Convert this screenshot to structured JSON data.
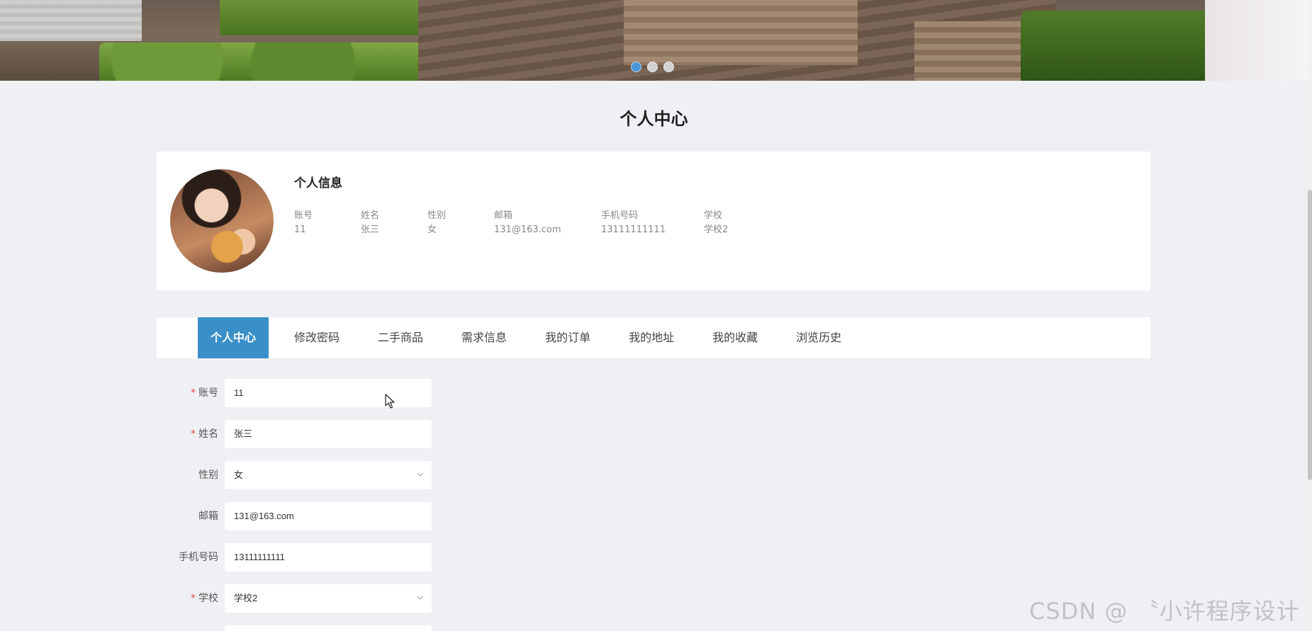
{
  "banner": {
    "slides": 3,
    "active_slide": 1,
    "accent_color": "#4a97d6"
  },
  "page": {
    "title": "个人中心"
  },
  "profile": {
    "heading": "个人信息",
    "fields": [
      {
        "key": "账号",
        "value": "11"
      },
      {
        "key": "姓名",
        "value": "张三"
      },
      {
        "key": "性别",
        "value": "女"
      },
      {
        "key": "邮箱",
        "value": "131@163.com"
      },
      {
        "key": "手机号码",
        "value": "13111111111"
      },
      {
        "key": "学校",
        "value": "学校2"
      }
    ]
  },
  "tabs": [
    {
      "label": "个人中心",
      "active": true
    },
    {
      "label": "修改密码"
    },
    {
      "label": "二手商品"
    },
    {
      "label": "需求信息"
    },
    {
      "label": "我的订单"
    },
    {
      "label": "我的地址"
    },
    {
      "label": "我的收藏"
    },
    {
      "label": "浏览历史"
    }
  ],
  "form": {
    "account": {
      "label": "账号",
      "required": "*",
      "value": "11"
    },
    "name": {
      "label": "姓名",
      "required": "*",
      "value": "张三"
    },
    "gender": {
      "label": "性别",
      "value": "女"
    },
    "email": {
      "label": "邮箱",
      "value": "131@163.com"
    },
    "phone": {
      "label": "手机号码",
      "value": "13111111111"
    },
    "school": {
      "label": "学校",
      "required": "*",
      "value": "学校2"
    }
  },
  "watermark": "CSDN @ 〝小许程序设计",
  "colors": {
    "tab_active": "#3a8fc8",
    "required": "#e24b4b",
    "background": "#eef0f3"
  }
}
